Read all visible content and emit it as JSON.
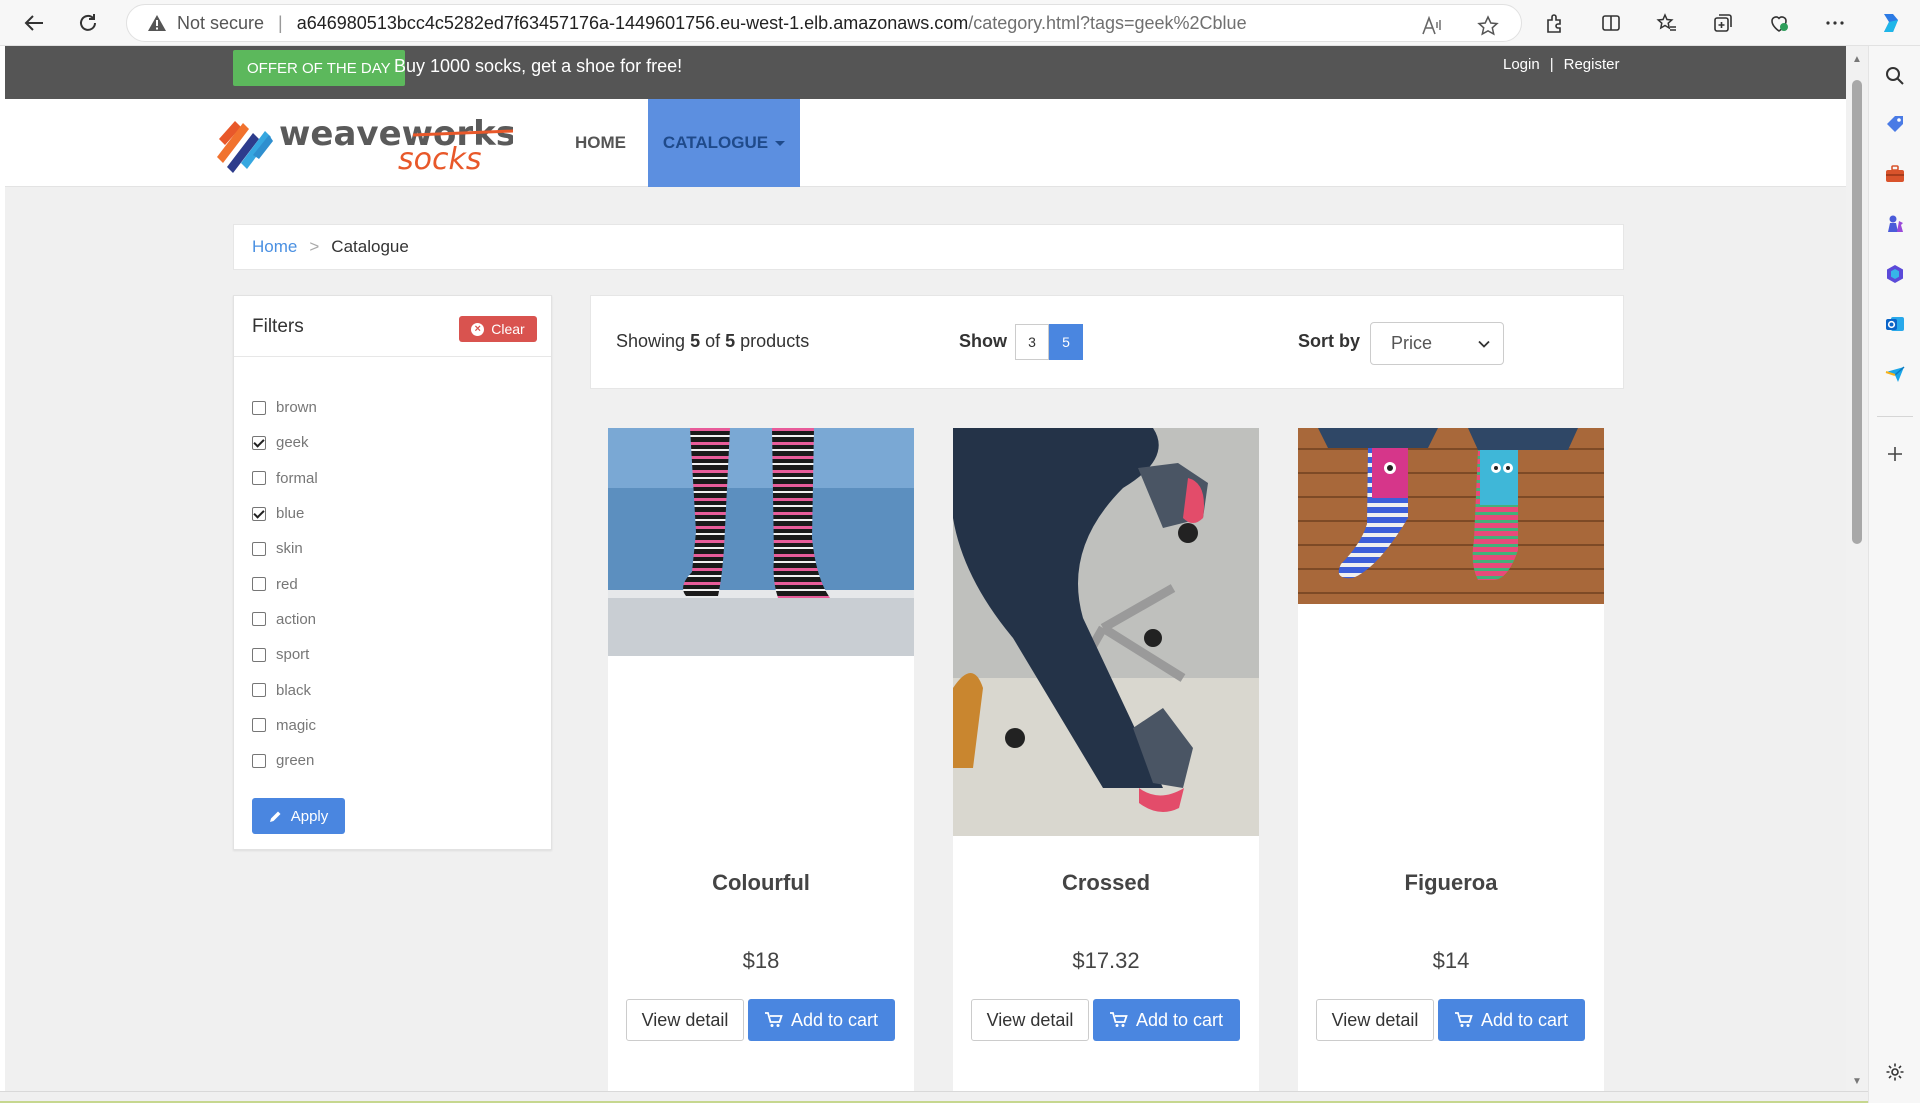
{
  "browser": {
    "not_secure_label": "Not secure",
    "url_host": "a646980513bcc4c5282ed7f63457176a-1449601756.eu-west-1.elb.amazonaws.com",
    "url_path": "/category.html?tags=geek%2Cblue"
  },
  "promo": {
    "badge": "OFFER OF THE DAY",
    "text": "Buy 1000 socks, get a shoe for free!"
  },
  "account": {
    "login": "Login",
    "separator": "|",
    "register": "Register"
  },
  "nav": {
    "logo_line1": "weaveworks",
    "logo_line2": "socks",
    "home": "HOME",
    "catalogue": "CATALOGUE"
  },
  "breadcrumb": {
    "home": "Home",
    "separator": ">",
    "current": "Catalogue"
  },
  "filters": {
    "title": "Filters",
    "clear_label": "Clear",
    "apply_label": "Apply",
    "items": [
      {
        "label": "brown",
        "checked": false
      },
      {
        "label": "geek",
        "checked": true
      },
      {
        "label": "formal",
        "checked": false
      },
      {
        "label": "blue",
        "checked": true
      },
      {
        "label": "skin",
        "checked": false
      },
      {
        "label": "red",
        "checked": false
      },
      {
        "label": "action",
        "checked": false
      },
      {
        "label": "sport",
        "checked": false
      },
      {
        "label": "black",
        "checked": false
      },
      {
        "label": "magic",
        "checked": false
      },
      {
        "label": "green",
        "checked": false
      }
    ]
  },
  "results": {
    "showing_prefix": "Showing",
    "showing_count": "5",
    "showing_of": "of",
    "showing_total": "5",
    "showing_suffix": "products",
    "show_label": "Show",
    "page_sizes": [
      "3",
      "5"
    ],
    "active_page_size": "5",
    "sort_label": "Sort by",
    "sort_value": "Price"
  },
  "products": [
    {
      "name": "Colourful",
      "price": "$18",
      "view_label": "View detail",
      "cart_label": "Add to cart"
    },
    {
      "name": "Crossed",
      "price": "$17.32",
      "view_label": "View detail",
      "cart_label": "Add to cart"
    },
    {
      "name": "Figueroa",
      "price": "$14",
      "view_label": "View detail",
      "cart_label": "Add to cart"
    }
  ],
  "colors": {
    "accent_blue": "#4a86e0",
    "offer_green": "#5cb85c",
    "clear_red": "#d9534f",
    "topbar_gray": "#555555"
  }
}
